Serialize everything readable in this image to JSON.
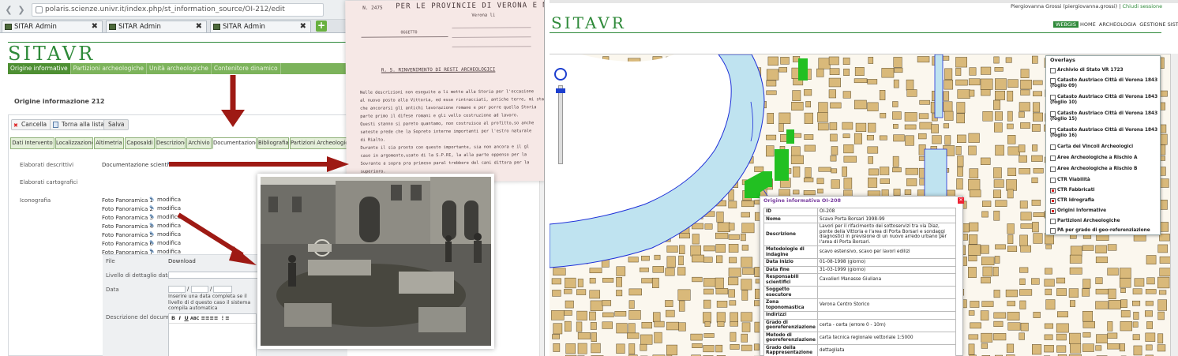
{
  "left_window": {
    "url": "polaris.scienze.univr.it/index.php/st_information_source/OI-212/edit",
    "tabs": [
      {
        "label": "SITAR Admin"
      },
      {
        "label": "SITAR Admin"
      },
      {
        "label": "SITAR Admin"
      }
    ],
    "new_tab": "+",
    "logo": "SITAVR",
    "menu": [
      "Origine informative",
      "Partizioni archeologiche",
      "Unità archeologiche",
      "Contenitore dinamico"
    ],
    "page_title": "Origine informazione 212",
    "buttons": {
      "cancel": "Cancella",
      "back": "Torna alla lista",
      "save": "Salva"
    },
    "form_tabs": [
      "Dati Intervento",
      "Localizzazione",
      "Altimetria",
      "Caposaldi",
      "Descrizione",
      "Archivio",
      "Documentazione",
      "Bibliografia",
      "Partizioni Archeologiche"
    ],
    "active_form_tab": "Documentazione",
    "rows": {
      "descrittivi_label": "Elaborati descrittivi",
      "descrittivi_value": "Documentazione scientifica",
      "cartografici_label": "Elaborati cartografici",
      "iconografici_label": "Iconografia"
    },
    "photos": [
      "Foto Panoramica 1",
      "Foto Panoramica 2",
      "Foto Panoramica 3",
      "Foto Panoramica 4",
      "Foto Panoramica 5",
      "Foto Panoramica 6",
      "Foto Panoramica 7"
    ],
    "modifica": "modifica",
    "doc_panel": {
      "file_label": "File",
      "file_value": "Download",
      "livello_label": "Livello di dettaglio data",
      "data_label": "Data",
      "data_hint": "Inserire una data completa se il livello di d questo caso il sistema compila automatica",
      "descr_label": "Descrizione del documento",
      "toolbar": [
        "B",
        "I",
        "U",
        "ABC",
        "≡",
        "≡",
        "≡",
        "≡",
        "⋮≡"
      ]
    }
  },
  "letter": {
    "header": "PER LE PROVINCIE DI VERONA E MANTOVA",
    "line1": "Verona li",
    "oggetto": "OGGETTO",
    "body": [
      "Nelle descrizioni non eseguite a li  mette alla Storia per l'occasione",
      "al nuovo posto alla Vittoria, ed esse rintracciati, antiche terre, mi sta",
      "che ancorarsi gli antichi lavorazione romane e per porre quella Storia",
      "parte primo il difese romani e gli vello costruzione ad lavoro.",
      "Questi stanno si pareto quantamo, non costruisce al profitto,so anche",
      "sateste prede che la Sopreto interne importanti per l'estro naturale",
      "di Rialto.",
      "Durante il sia pronto con questo importante, sia non ancora e il gl",
      "caso in argomento,usato di la S.P.RI, la alla parte oppenso per la",
      "Sovrante a sopra pra primeso paral trebbere del cani dittora per la",
      "superioro."
    ]
  },
  "right_window": {
    "user_text": "Piergiovanna Grossi (piergiovanna.grossi)",
    "logout": "Chiudi sessione",
    "logo": "SITAVR",
    "nav": [
      "WEBGIS",
      "HOME",
      "ARCHEOLOGIA",
      "GESTIONE SISTEMA"
    ],
    "overlays_title": "Overlays",
    "overlays": [
      {
        "label": "Archivio di Stato VR 1723",
        "checked": false
      },
      {
        "label": "Catasto Austriaco Città di Verona 1843 (foglio 09)",
        "checked": false
      },
      {
        "label": "Catasto Austriaco Città di Verona 1843 (foglio 10)",
        "checked": false
      },
      {
        "label": "Catasto Austriaco Città di Verona 1843 (foglio 15)",
        "checked": false
      },
      {
        "label": "Catasto Austriaco Città di Verona 1843 (foglio 16)",
        "checked": false
      },
      {
        "label": "Carta dei Vincoli Archeologici",
        "checked": false
      },
      {
        "label": "Aree Archeologiche a Rischio A",
        "checked": false
      },
      {
        "label": "Aree Archeologiche a Rischio B",
        "checked": false
      },
      {
        "label": "CTR Viabilità",
        "checked": false
      },
      {
        "label": "CTR Fabbricati",
        "checked": true
      },
      {
        "label": "CTR Idrografia",
        "checked": true
      },
      {
        "label": "Origini Informative",
        "checked": true
      },
      {
        "label": "Partizioni Archeologiche",
        "checked": false
      },
      {
        "label": "PA per grado di geo-referenziazione",
        "checked": false
      }
    ],
    "popup": {
      "title": "Origine informativa OI-208",
      "rows": [
        {
          "k": "ID",
          "v": "OI-208"
        },
        {
          "k": "Nome",
          "v": "Scavo Porta Borsari 1998-99"
        },
        {
          "k": "Descrizione",
          "v": "Lavori per il rifacimento dei sottoservizi tra via Diaz, ponte della Vittoria e l'area di Porta Borsari e sondaggi diagnostici in previsione di un nuovo arredo urbano per l'area di Porta Borsari."
        },
        {
          "k": "Metodologie di indagine",
          "v": "scavo estensivo, scavo per lavori edilizi"
        },
        {
          "k": "Data inizio",
          "v": "01-08-1998 (giorno)"
        },
        {
          "k": "Data fine",
          "v": "31-03-1999 (giorno)"
        },
        {
          "k": "Responsabili scientifici",
          "v": "Cavalieri Manasse Giuliana"
        },
        {
          "k": "Soggetto esecutore",
          "v": ""
        },
        {
          "k": "Zona toponomastica",
          "v": "Verona Centro Storico"
        },
        {
          "k": "Indirizzi",
          "v": ""
        },
        {
          "k": "Grado di georeferenziazione",
          "v": "certa - certa (errore 0 - 10m)"
        },
        {
          "k": "Metodo di georeferenziazione",
          "v": "carta tecnica regionale vettoriale 1:5000"
        },
        {
          "k": "Grado della Rappresentazione",
          "v": "dettagliata"
        }
      ]
    }
  },
  "colors": {
    "green": "#2f8a3a",
    "menu_green": "#7cb35b",
    "river": "#bfe3f0",
    "buildings": "#d9b97a",
    "highlight": "#22c022",
    "arrow": "#9e1a14"
  }
}
